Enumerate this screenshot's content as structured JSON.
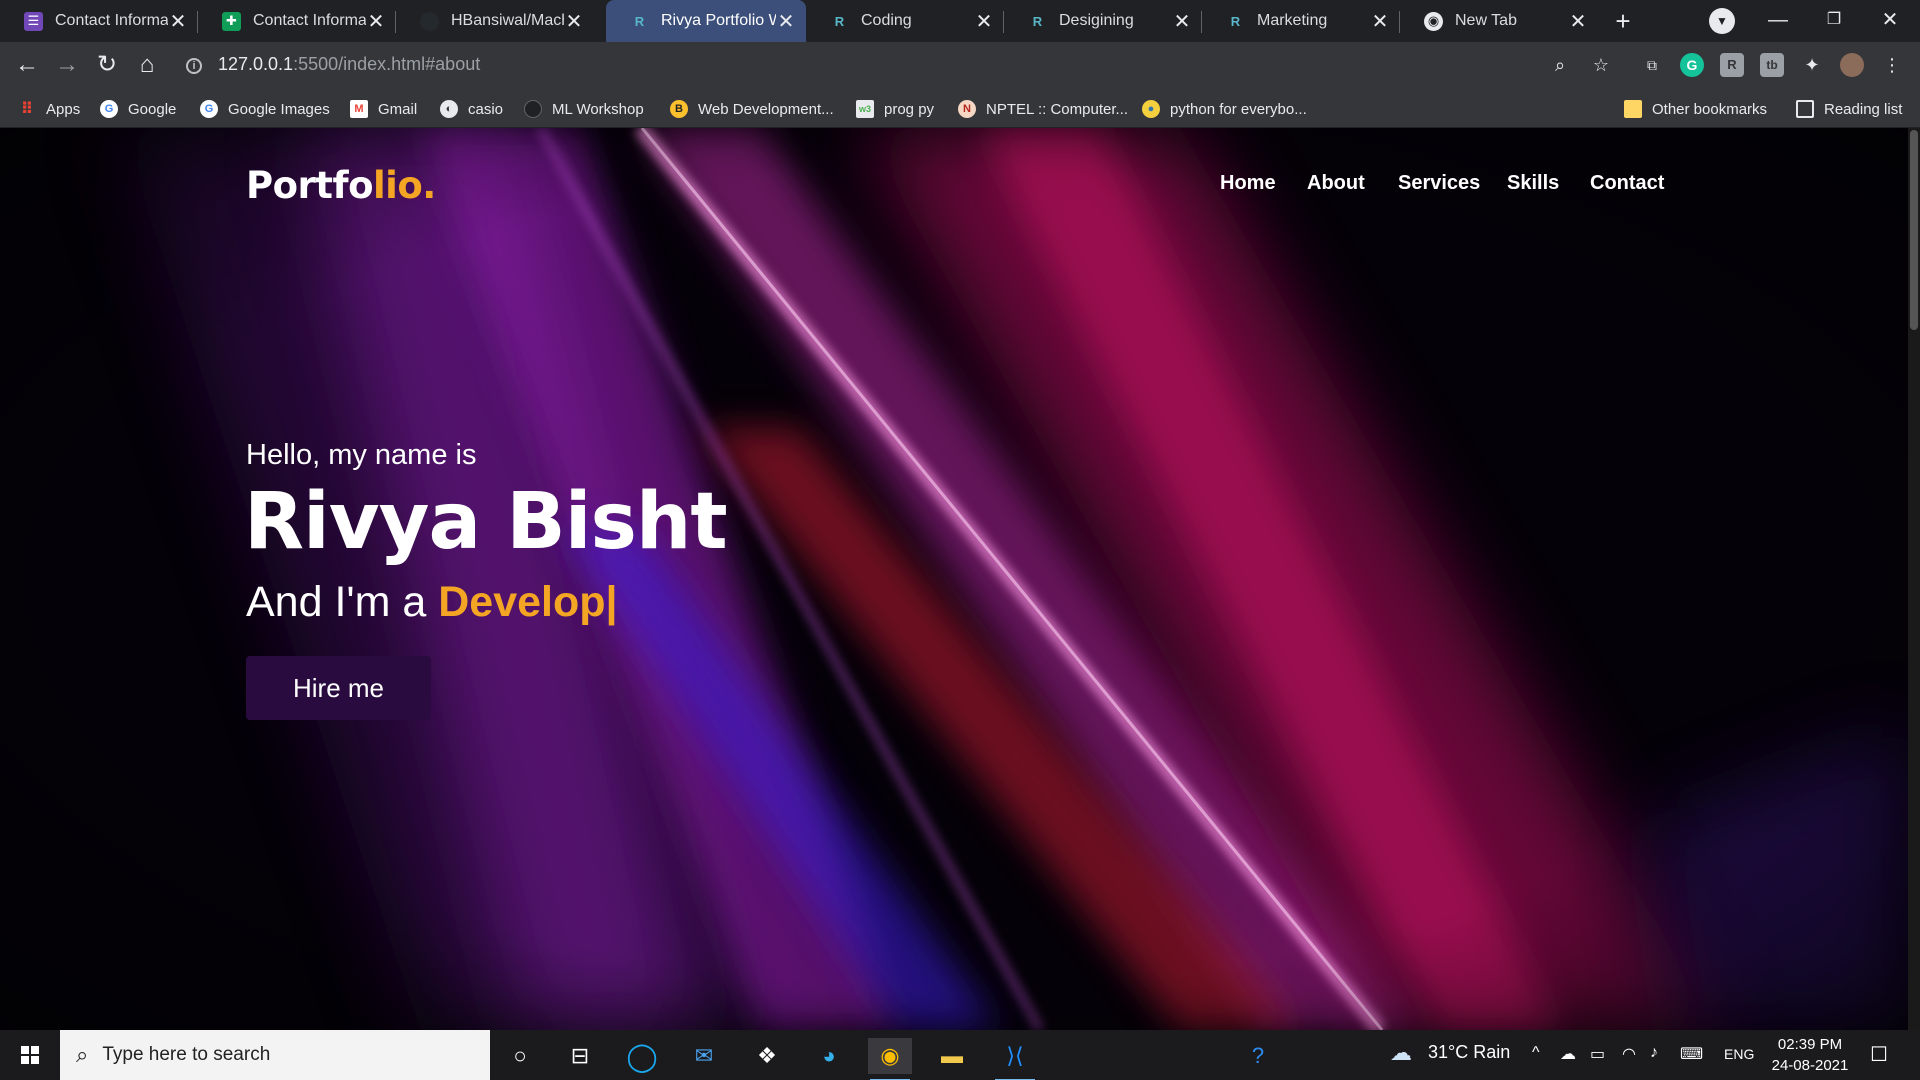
{
  "tabs": [
    {
      "title": "Contact Informati",
      "icon": "forms-icon",
      "color": "#7248b9"
    },
    {
      "title": "Contact Informati",
      "icon": "sheets-icon",
      "color": "#0f9d58"
    },
    {
      "title": "HBansiwal/Machir",
      "icon": "github-icon",
      "color": "#24292e"
    },
    {
      "title": "Rivya Portfolio We",
      "icon": "replit-icon",
      "color": "#56676d",
      "active": true
    },
    {
      "title": "Coding",
      "icon": "replit-icon",
      "color": "#56676d"
    },
    {
      "title": "Desigining",
      "icon": "replit-icon",
      "color": "#56676d"
    },
    {
      "title": "Marketing",
      "icon": "replit-icon",
      "color": "#56676d"
    },
    {
      "title": "New Tab",
      "icon": "chrome-icon",
      "color": "#e8eaed"
    }
  ],
  "address": {
    "host": "127.0.0.1",
    "path": ":5500/index.html#about"
  },
  "bookmarks": [
    {
      "label": "Apps",
      "icon": "apps-grid-icon"
    },
    {
      "label": "Google",
      "icon": "google-icon"
    },
    {
      "label": "Google Images",
      "icon": "google-icon"
    },
    {
      "label": "Gmail",
      "icon": "gmail-icon"
    },
    {
      "label": "casio",
      "icon": "globe-icon"
    },
    {
      "label": "ML Workshop",
      "icon": "github-icon"
    },
    {
      "label": "Web Development...",
      "icon": "bookmark-site-icon"
    },
    {
      "label": "prog py",
      "icon": "w3schools-icon"
    },
    {
      "label": "NPTEL :: Computer...",
      "icon": "nptel-icon"
    },
    {
      "label": "python for everybo...",
      "icon": "python-icon"
    }
  ],
  "bookmarks_right": {
    "other": "Other bookmarks",
    "reading": "Reading list"
  },
  "site": {
    "logo_main": "Portfo",
    "logo_accent": "lio.",
    "nav": [
      "Home",
      "About",
      "Services",
      "Skills",
      "Contact"
    ],
    "hello": "Hello, my name is",
    "name": "Rivya Bisht",
    "role_prefix": "And I'm a ",
    "role_typed": "Develop",
    "cursor": "|",
    "hire": "Hire me"
  },
  "taskbar": {
    "search_placeholder": "Type here to search",
    "weather": "31°C  Rain",
    "lang": "ENG",
    "time": "02:39 PM",
    "date": "24-08-2021"
  },
  "colors": {
    "accent": "#f5a524",
    "hire_bg": "#2a0b3f",
    "chrome_dark": "#202124",
    "toolbar": "#35363a"
  }
}
